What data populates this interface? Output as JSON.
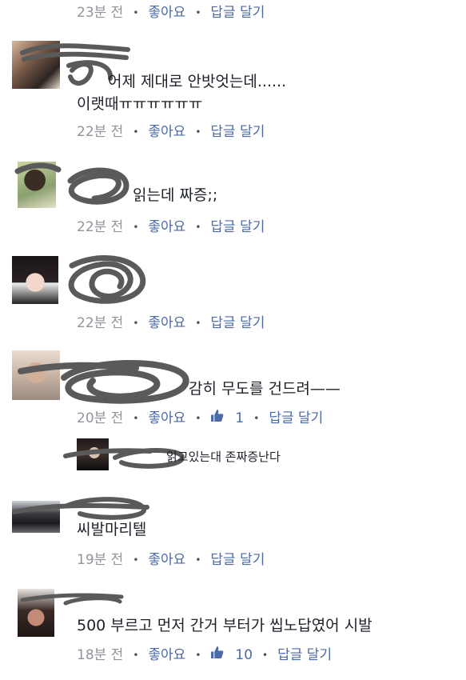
{
  "colors": {
    "link": "#4b6aa8",
    "meta": "#90949c",
    "text": "#1d2129",
    "scribble": "#5a5a5a"
  },
  "actions": {
    "like": "좋아요",
    "reply": "답글 달기"
  },
  "comments": [
    {
      "text": "",
      "time": "23분 전",
      "likes": ""
    },
    {
      "text_line1": "어제 제대로 안밧엇는데......",
      "text_line2": "이랫때ㅠㅠㅠㅠㅠㅠ",
      "time": "22분 전",
      "likes": ""
    },
    {
      "text": "읽는데 짜증;;",
      "time": "22분 전",
      "likes": ""
    },
    {
      "text": "",
      "time": "22분 전",
      "likes": ""
    },
    {
      "text": "감히 무도를 건드려——",
      "time": "20분 전",
      "likes": "1",
      "reply": {
        "text": "읽고있는대 존짜증난다"
      }
    },
    {
      "text": "씨발마리텔",
      "time": "19분 전",
      "likes": ""
    },
    {
      "text": "500 부르고 먼저 간거 부터가 씹노답였어 시발",
      "time": "18분 전",
      "likes": "10"
    }
  ],
  "icons": {
    "like": "thumbs-up-icon",
    "avatar": "profile-photo"
  }
}
